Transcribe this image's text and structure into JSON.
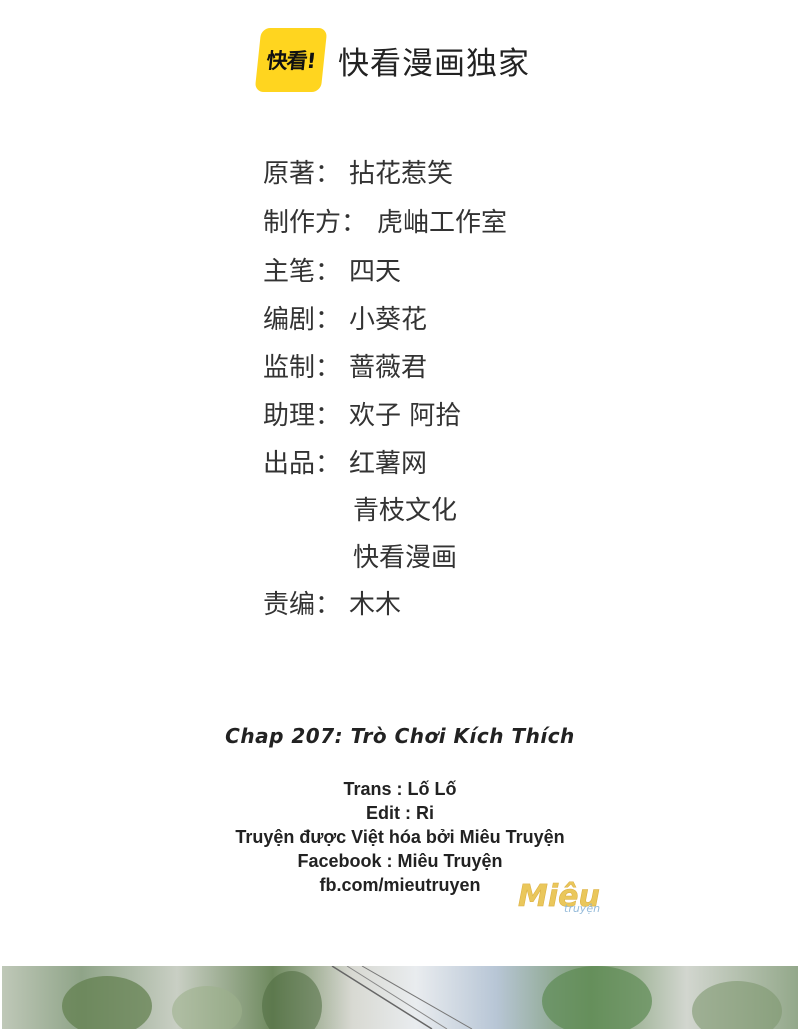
{
  "logo": {
    "badge_text": "快看!",
    "label": "快看漫画独家",
    "badge_color": "#ffd51f"
  },
  "credits": [
    {
      "role": "原著：",
      "value": "拈花惹笑"
    },
    {
      "role": "制作方：",
      "value": "虎岫工作室"
    },
    {
      "role": "主笔：",
      "value": "四天"
    },
    {
      "role": "编剧：",
      "value": "小葵花"
    },
    {
      "role": "监制：",
      "value": "蔷薇君"
    },
    {
      "role": "助理：",
      "value": "欢子 阿拾"
    },
    {
      "role": "出品：",
      "value": "红薯网"
    },
    {
      "role": "",
      "value": "青枝文化"
    },
    {
      "role": "",
      "value": "快看漫画"
    },
    {
      "role": "责编：",
      "value": "木木"
    }
  ],
  "chapter": {
    "title": "Chap 207: Trò Chơi Kích Thích"
  },
  "translation": {
    "lines": [
      "Trans : Lố Lố",
      "Edit : Ri",
      "Truyện được Việt hóa bởi Miêu Truyện",
      "Facebook : Miêu Truyện",
      "fb.com/mieutruyen"
    ]
  },
  "watermark": {
    "text_main": "Miêu",
    "text_sub": "truyện",
    "color": "#e8c24a"
  }
}
